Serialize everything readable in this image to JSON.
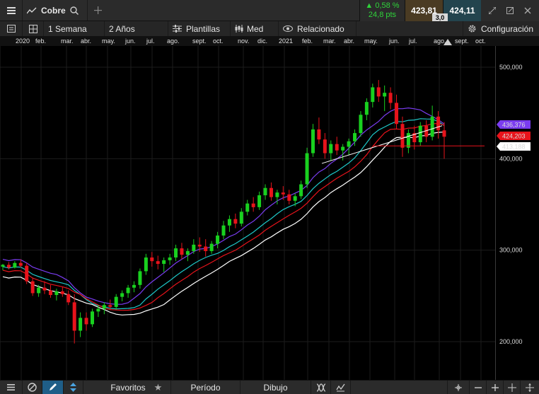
{
  "header": {
    "symbol": "Cobre",
    "change_pct": "0,58 %",
    "change_pts": "24,8 pts",
    "bid": "423,81",
    "ask": "424,11",
    "spread": "3,0"
  },
  "toolbar": {
    "interval": "1 Semana",
    "range": "2 Años",
    "templates": "Plantillas",
    "chart_type": "Med",
    "related": "Relacionado",
    "settings": "Configuración"
  },
  "time_axis": {
    "labels": [
      "2020",
      "feb.",
      "mar.",
      "abr.",
      "may.",
      "jun.",
      "jul.",
      "ago.",
      "sept.",
      "oct.",
      "nov.",
      "dic.",
      "2021",
      "feb.",
      "mar.",
      "abr.",
      "may.",
      "jun.",
      "jul.",
      "ago.",
      "sept.",
      "oct."
    ]
  },
  "price_axis": {
    "ticks": [
      "500,000",
      "400,000",
      "300,000",
      "200,000"
    ],
    "tags": [
      {
        "label": "436,376",
        "color": "#7a3cf0"
      },
      {
        "label": "424,203",
        "color": "#e8131b"
      },
      {
        "label": "413,188",
        "color": "#ffffff"
      }
    ]
  },
  "bottom": {
    "favorites": "Favoritos",
    "period": "Período",
    "drawing": "Dibujo"
  },
  "chart_data": {
    "type": "candlestick",
    "ylim": [
      180,
      520
    ],
    "colors": {
      "up": "#19d11f",
      "down": "#e8131b",
      "ma1": "#7a3cf0",
      "ma2": "#e8131b",
      "ma3": "#ffffff",
      "ma4": "#1ec8c8"
    },
    "candles": [
      [
        282,
        285,
        278,
        284
      ],
      [
        284,
        287,
        279,
        281
      ],
      [
        281,
        288,
        280,
        286
      ],
      [
        286,
        290,
        281,
        283
      ],
      [
        283,
        286,
        263,
        266
      ],
      [
        266,
        270,
        250,
        253
      ],
      [
        253,
        262,
        249,
        259
      ],
      [
        259,
        266,
        252,
        256
      ],
      [
        256,
        262,
        248,
        251
      ],
      [
        251,
        258,
        245,
        255
      ],
      [
        255,
        260,
        249,
        252
      ],
      [
        252,
        256,
        240,
        243
      ],
      [
        243,
        252,
        198,
        212
      ],
      [
        212,
        232,
        205,
        226
      ],
      [
        226,
        232,
        212,
        219
      ],
      [
        219,
        236,
        216,
        233
      ],
      [
        233,
        240,
        227,
        236
      ],
      [
        236,
        243,
        230,
        240
      ],
      [
        240,
        246,
        235,
        238
      ],
      [
        238,
        252,
        235,
        249
      ],
      [
        249,
        256,
        244,
        253
      ],
      [
        253,
        262,
        248,
        259
      ],
      [
        259,
        266,
        254,
        262
      ],
      [
        262,
        280,
        258,
        277
      ],
      [
        277,
        296,
        273,
        292
      ],
      [
        292,
        298,
        282,
        288
      ],
      [
        288,
        294,
        279,
        285
      ],
      [
        285,
        292,
        276,
        289
      ],
      [
        289,
        296,
        284,
        292
      ],
      [
        292,
        306,
        288,
        302
      ],
      [
        302,
        308,
        290,
        295
      ],
      [
        295,
        302,
        288,
        299
      ],
      [
        299,
        312,
        296,
        306
      ],
      [
        306,
        314,
        298,
        304
      ],
      [
        304,
        312,
        293,
        299
      ],
      [
        299,
        310,
        296,
        307
      ],
      [
        307,
        320,
        302,
        316
      ],
      [
        316,
        332,
        312,
        327
      ],
      [
        327,
        338,
        320,
        334
      ],
      [
        334,
        340,
        324,
        329
      ],
      [
        329,
        346,
        326,
        342
      ],
      [
        342,
        355,
        338,
        351
      ],
      [
        351,
        358,
        342,
        347
      ],
      [
        347,
        364,
        344,
        360
      ],
      [
        360,
        372,
        355,
        368
      ],
      [
        368,
        374,
        354,
        358
      ],
      [
        358,
        366,
        350,
        363
      ],
      [
        363,
        370,
        355,
        361
      ],
      [
        361,
        366,
        350,
        354
      ],
      [
        354,
        362,
        348,
        359
      ],
      [
        359,
        376,
        356,
        372
      ],
      [
        372,
        412,
        368,
        406
      ],
      [
        406,
        438,
        402,
        432
      ],
      [
        432,
        445,
        416,
        421
      ],
      [
        421,
        428,
        400,
        406
      ],
      [
        406,
        420,
        398,
        416
      ],
      [
        416,
        424,
        404,
        409
      ],
      [
        409,
        416,
        398,
        413
      ],
      [
        413,
        422,
        404,
        419
      ],
      [
        419,
        432,
        414,
        428
      ],
      [
        428,
        452,
        424,
        448
      ],
      [
        448,
        466,
        442,
        462
      ],
      [
        462,
        482,
        456,
        478
      ],
      [
        478,
        486,
        462,
        468
      ],
      [
        468,
        480,
        452,
        472
      ],
      [
        472,
        478,
        454,
        461
      ],
      [
        461,
        470,
        432,
        438
      ],
      [
        438,
        446,
        402,
        412
      ],
      [
        412,
        432,
        406,
        428
      ],
      [
        428,
        436,
        410,
        418
      ],
      [
        418,
        440,
        414,
        436
      ],
      [
        436,
        442,
        418,
        424
      ],
      [
        424,
        458,
        420,
        446
      ],
      [
        446,
        452,
        422,
        431
      ],
      [
        431,
        440,
        400,
        424
      ]
    ],
    "trendline": [
      [
        455,
        418
      ],
      [
        625,
        436
      ]
    ],
    "hline": [
      [
        527,
        414
      ],
      [
        685,
        414
      ]
    ]
  }
}
